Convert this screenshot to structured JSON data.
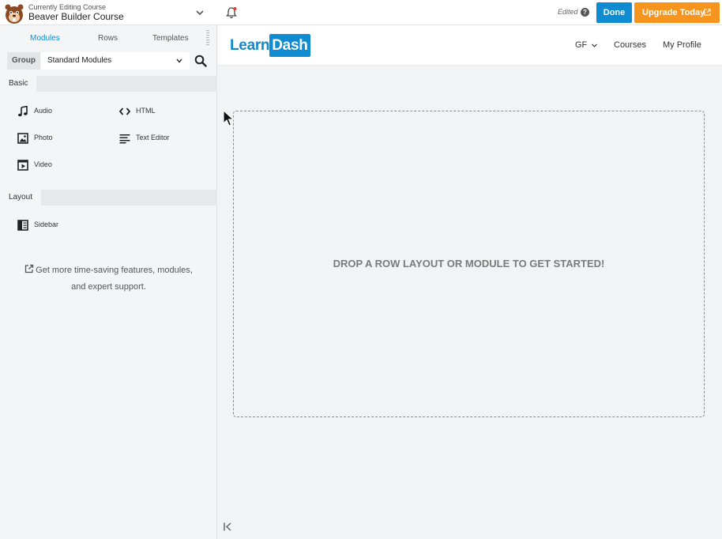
{
  "topbar": {
    "context_small": "Currently Editing Course",
    "context_title": "Beaver Builder Course",
    "status": "Edited",
    "help_glyph": "?",
    "done_label": "Done",
    "upgrade_label": "Upgrade Today",
    "icons": [
      "beaver-logo-icon",
      "chevron-down-icon",
      "bell-icon",
      "help-icon",
      "external-link-icon"
    ],
    "colors": {
      "done": "#0e8bd1",
      "upgrade": "#f7941d",
      "notification_dot": "#e53935"
    }
  },
  "panel": {
    "tabs": [
      "Modules",
      "Rows",
      "Templates"
    ],
    "active_tab": "Modules",
    "group_label": "Group",
    "group_value": "Standard Modules",
    "sections": [
      {
        "title": "Basic",
        "modules": [
          {
            "label": "Audio",
            "icon": "music-note-icon"
          },
          {
            "label": "HTML",
            "icon": "code-icon"
          },
          {
            "label": "Photo",
            "icon": "photo-icon"
          },
          {
            "label": "Text Editor",
            "icon": "text-lines-icon"
          },
          {
            "label": "Video",
            "icon": "video-icon"
          }
        ]
      },
      {
        "title": "Layout",
        "modules": [
          {
            "label": "Sidebar",
            "icon": "sidebar-icon"
          }
        ]
      }
    ],
    "promo_line1": "Get more time-saving features, modules,",
    "promo_line2": "and expert support."
  },
  "site": {
    "logo_part1": "Learn",
    "logo_part2": "Dash",
    "nav": [
      "GF",
      "Courses",
      "My Profile"
    ]
  },
  "canvas": {
    "drop_message": "DROP A ROW LAYOUT OR MODULE TO GET STARTED!"
  }
}
